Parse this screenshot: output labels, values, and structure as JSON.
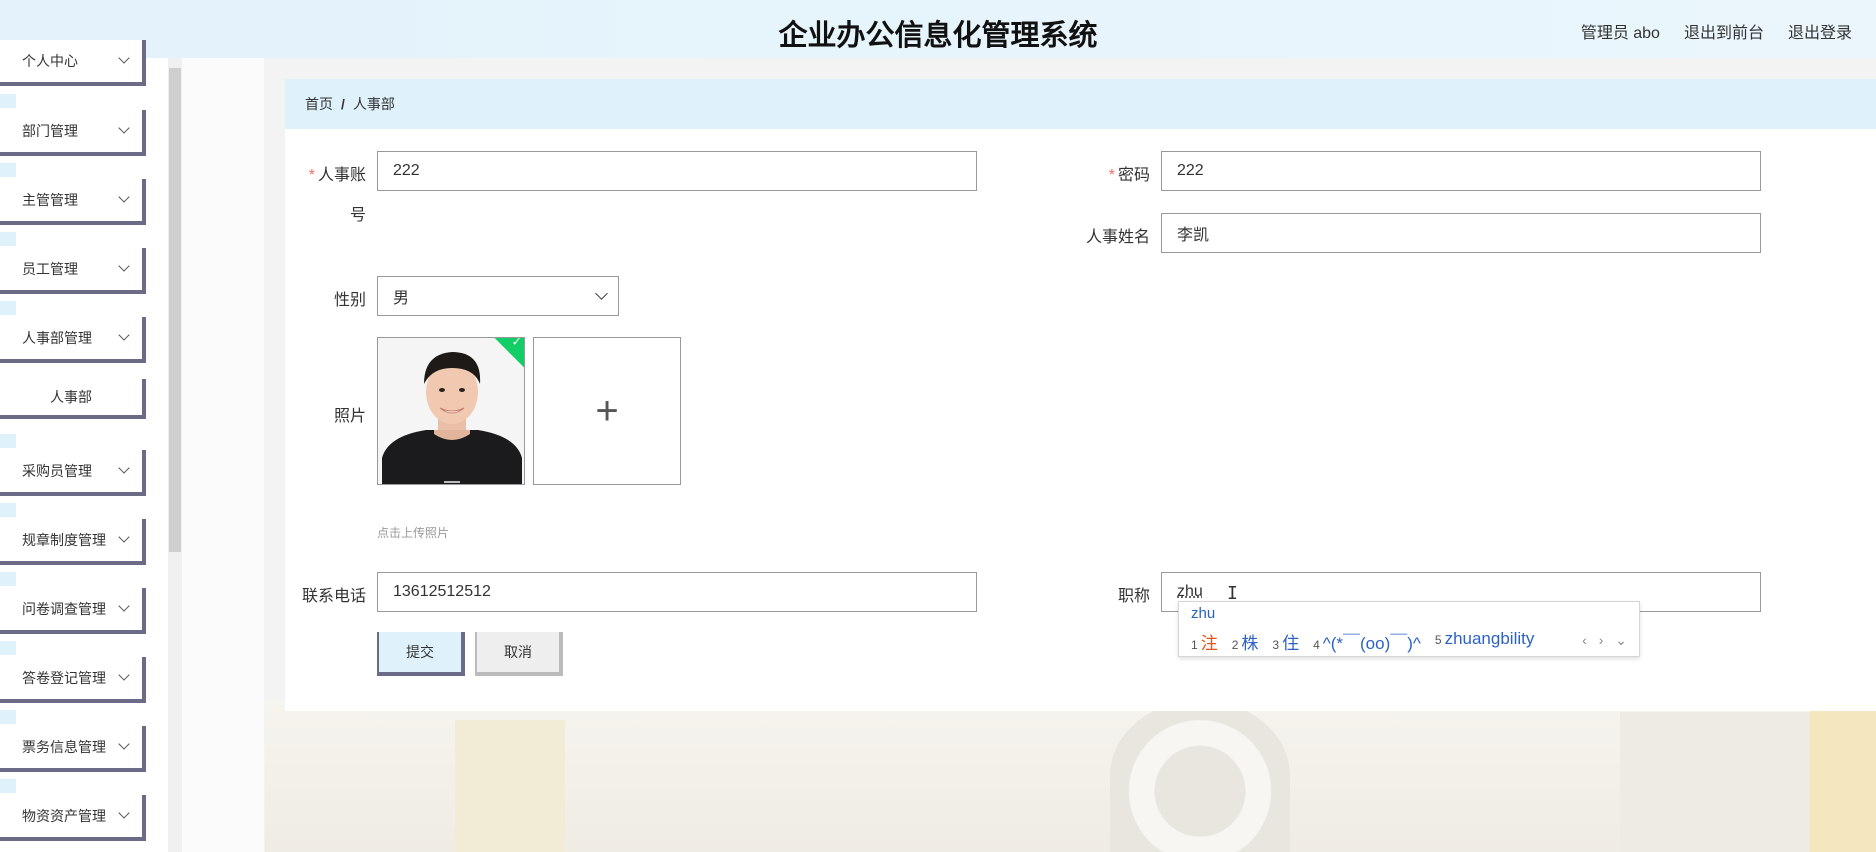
{
  "header": {
    "title": "企业办公信息化管理系统",
    "user_label": "管理员 abo",
    "front_link": "退出到前台",
    "logout_link": "退出登录"
  },
  "sidebar": {
    "items": [
      {
        "label": "个人中心"
      },
      {
        "label": "部门管理"
      },
      {
        "label": "主管管理"
      },
      {
        "label": "员工管理"
      },
      {
        "label": "人事部管理"
      },
      {
        "label": "人事部"
      },
      {
        "label": "采购员管理"
      },
      {
        "label": "规章制度管理"
      },
      {
        "label": "问卷调查管理"
      },
      {
        "label": "答卷登记管理"
      },
      {
        "label": "票务信息管理"
      },
      {
        "label": "物资资产管理"
      }
    ]
  },
  "breadcrumb": {
    "home": "首页",
    "sep": "/",
    "current": "人事部"
  },
  "form": {
    "account_label_1": "人事账",
    "account_label_2": "号",
    "account_value": "222",
    "password_label": "密码",
    "password_value": "222",
    "name_label": "人事姓名",
    "name_value": "李凯",
    "gender_label": "性别",
    "gender_value": "男",
    "photo_label": "照片",
    "upload_tip": "点击上传照片",
    "phone_label": "联系电话",
    "phone_value": "13612512512",
    "title_label": "职称",
    "title_value": "zhu",
    "required_mark": "*",
    "plus": "+",
    "check": "✓"
  },
  "buttons": {
    "submit": "提交",
    "cancel": "取消"
  },
  "ime": {
    "composition": "zhu",
    "candidates": [
      {
        "num": "1",
        "text": "注"
      },
      {
        "num": "2",
        "text": "株"
      },
      {
        "num": "3",
        "text": "住"
      },
      {
        "num": "4",
        "text": "^(*￣(oo)￣)^"
      },
      {
        "num": "5",
        "text": "zhuangbility"
      }
    ],
    "nav": "‹ › ⌄"
  }
}
